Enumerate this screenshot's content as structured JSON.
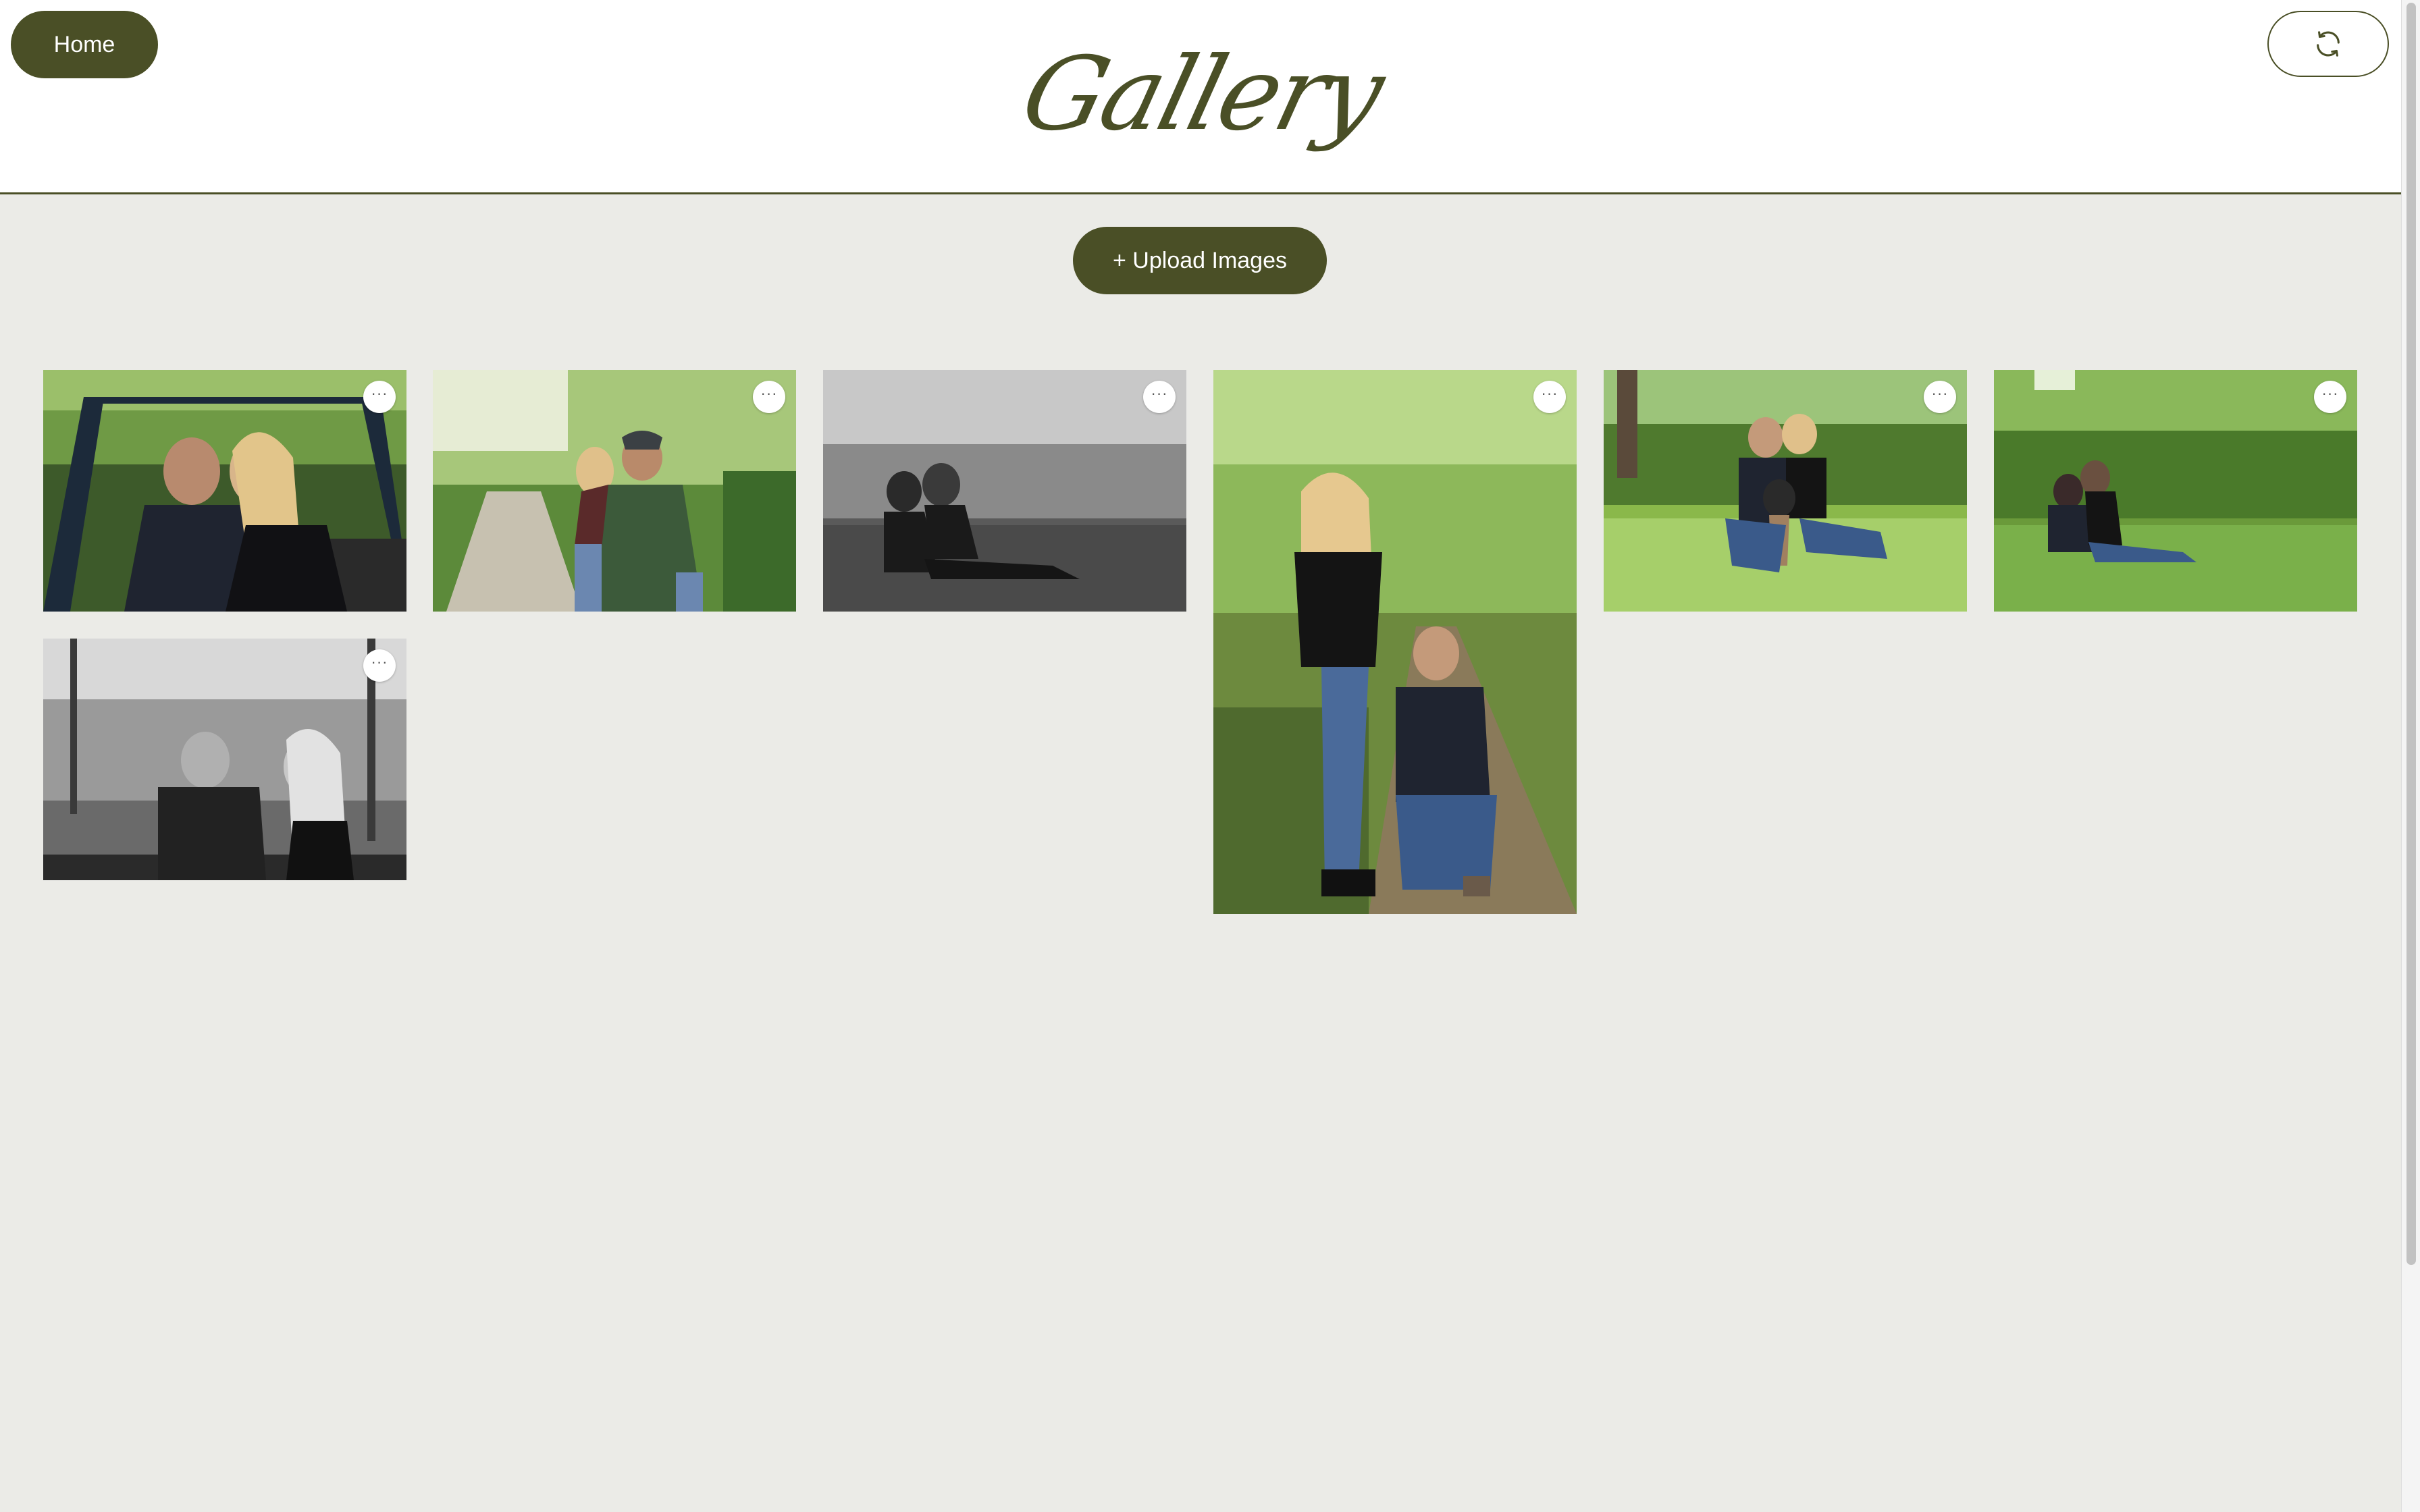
{
  "header": {
    "home_label": "Home",
    "title": "Gallery",
    "refresh_icon": "refresh-icon"
  },
  "toolbar": {
    "upload_label": "+ Upload Images"
  },
  "gallery": {
    "more_icon": "more-horizontal-icon",
    "more_label": "···",
    "images": [
      {
        "scene": "couple on bridge",
        "style": "color"
      },
      {
        "scene": "piggyback on forest path",
        "style": "color"
      },
      {
        "scene": "couple sitting in grass",
        "style": "black-and-white"
      },
      {
        "scene": "couple standing on trail",
        "style": "color"
      },
      {
        "scene": "couple with dog in meadow",
        "style": "color"
      },
      {
        "scene": "couple sitting in meadow",
        "style": "color"
      },
      {
        "scene": "couple on bridge facing each other",
        "style": "black-and-white"
      }
    ]
  },
  "colors": {
    "accent": "#4a4f26",
    "background": "#ebebe7",
    "header_bg": "#ffffff"
  }
}
